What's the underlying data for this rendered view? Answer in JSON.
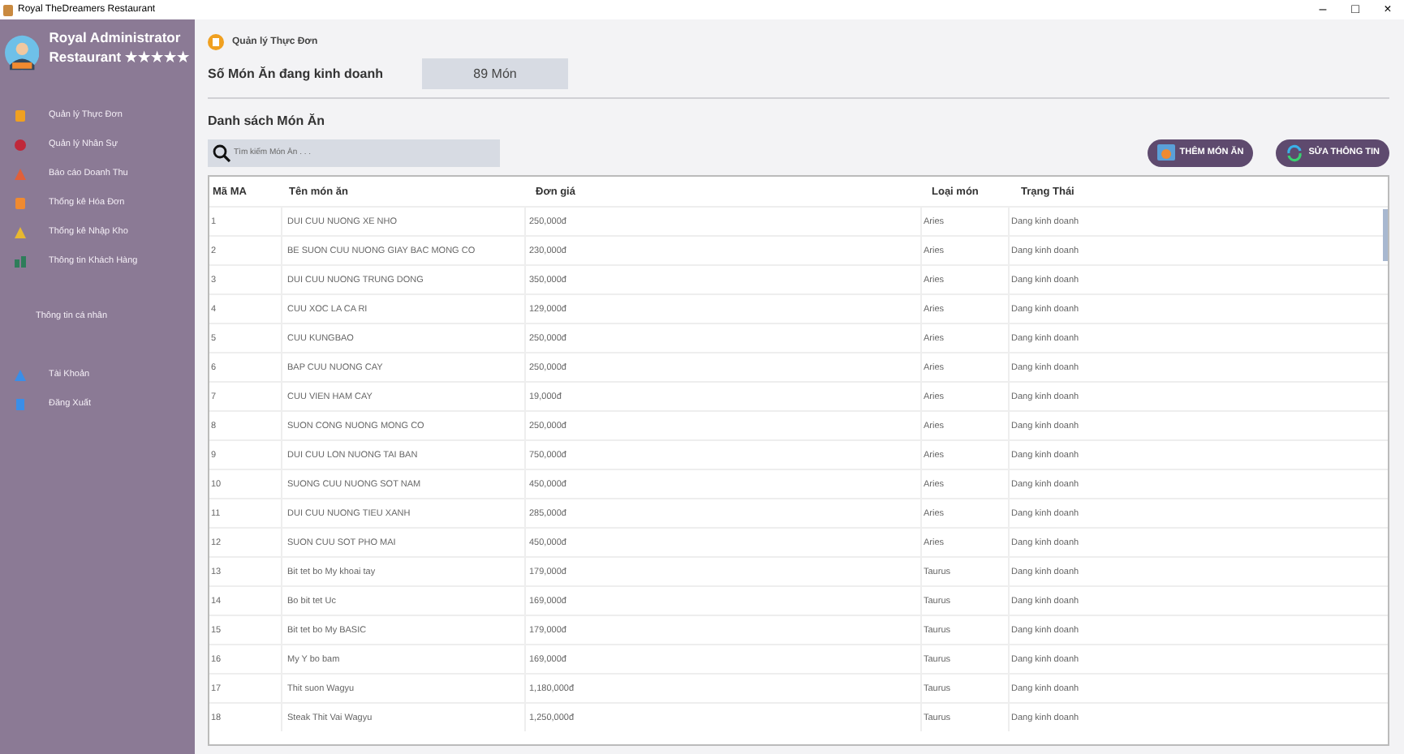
{
  "window": {
    "title": "Royal TheDreamers Restaurant",
    "controls": [
      "–",
      "□",
      "×"
    ]
  },
  "sidebar": {
    "title": "Royal Administrator",
    "subtitle": "Restaurant ★★★★★",
    "items": [
      {
        "label": "Quản lý Thực Đơn",
        "kind": "menu",
        "color": "#f0a020"
      },
      {
        "label": "Quản lý Nhân Sự",
        "kind": "staff",
        "color": "#c0283a"
      },
      {
        "label": "Báo cáo Doanh Thu",
        "kind": "chart",
        "color": "#e0603a"
      },
      {
        "label": "Thống kê Hóa Đơn",
        "kind": "bill",
        "color": "#f08a30"
      },
      {
        "label": "Thống kê Nhập Kho",
        "kind": "box",
        "color": "#e8b830"
      },
      {
        "label": "Thông tin Khách Hàng",
        "kind": "people",
        "color": "#2e7d5a"
      }
    ],
    "section": "Thông tin cá nhân",
    "account_items": [
      {
        "label": "Tài Khoản",
        "kind": "user",
        "color": "#3a8ee8"
      },
      {
        "label": "Đăng Xuất",
        "kind": "logout",
        "color": "#3a8ee8"
      }
    ]
  },
  "breadcrumb": "Quản lý Thực Đơn",
  "summary": {
    "label": "Số Món Ăn đang kinh doanh",
    "value": "89 Món"
  },
  "list_title": "Danh sách Món Ăn",
  "search": {
    "placeholder": "Tìm kiếm Món Ăn . . ."
  },
  "buttons": [
    {
      "label": "THÊM MÓN ĂN",
      "kind": "add"
    },
    {
      "label": "SỬA THÔNG TIN",
      "kind": "edit"
    }
  ],
  "table": {
    "columns": [
      "Mã MA",
      "Tên món ăn",
      "Đơn giá",
      "Loại món",
      "Trạng Thái"
    ],
    "rows": [
      [
        "1",
        "DUI CUU NUONG XE NHO",
        "250,000đ",
        "Aries",
        "Dang kinh doanh"
      ],
      [
        "2",
        "BE SUON CUU NUONG GIAY BAC MONG CO",
        "230,000đ",
        "Aries",
        "Dang kinh doanh"
      ],
      [
        "3",
        "DUI CUU NUONG TRUNG DONG",
        "350,000đ",
        "Aries",
        "Dang kinh doanh"
      ],
      [
        "4",
        "CUU XOC LA CA RI",
        "129,000đ",
        "Aries",
        "Dang kinh doanh"
      ],
      [
        "5",
        "CUU KUNGBAO",
        "250,000đ",
        "Aries",
        "Dang kinh doanh"
      ],
      [
        "6",
        "BAP CUU NUONG CAY",
        "250,000đ",
        "Aries",
        "Dang kinh doanh"
      ],
      [
        "7",
        "CUU VIEN HAM CAY",
        "19,000đ",
        "Aries",
        "Dang kinh doanh"
      ],
      [
        "8",
        "SUON CONG NUONG MONG CO",
        "250,000đ",
        "Aries",
        "Dang kinh doanh"
      ],
      [
        "9",
        "DUI CUU LON NUONG TAI BAN",
        "750,000đ",
        "Aries",
        "Dang kinh doanh"
      ],
      [
        "10",
        "SUONG CUU NUONG SOT NAM",
        "450,000đ",
        "Aries",
        "Dang kinh doanh"
      ],
      [
        "11",
        "DUI CUU NUONG TIEU XANH",
        "285,000đ",
        "Aries",
        "Dang kinh doanh"
      ],
      [
        "12",
        "SUON CUU SOT PHO MAI",
        "450,000đ",
        "Aries",
        "Dang kinh doanh"
      ],
      [
        "13",
        "Bit tet bo My khoai tay",
        "179,000đ",
        "Taurus",
        "Dang kinh doanh"
      ],
      [
        "14",
        "Bo bit tet Uc",
        "169,000đ",
        "Taurus",
        "Dang kinh doanh"
      ],
      [
        "15",
        "Bit tet bo My BASIC",
        "179,000đ",
        "Taurus",
        "Dang kinh doanh"
      ],
      [
        "16",
        "My Y bo bam",
        "169,000đ",
        "Taurus",
        "Dang kinh doanh"
      ],
      [
        "17",
        "Thit suon Wagyu",
        "1,180,000đ",
        "Taurus",
        "Dang kinh doanh"
      ],
      [
        "18",
        "Steak Thit Vai Wagyu",
        "1,250,000đ",
        "Taurus",
        "Dang kinh doanh"
      ]
    ]
  }
}
